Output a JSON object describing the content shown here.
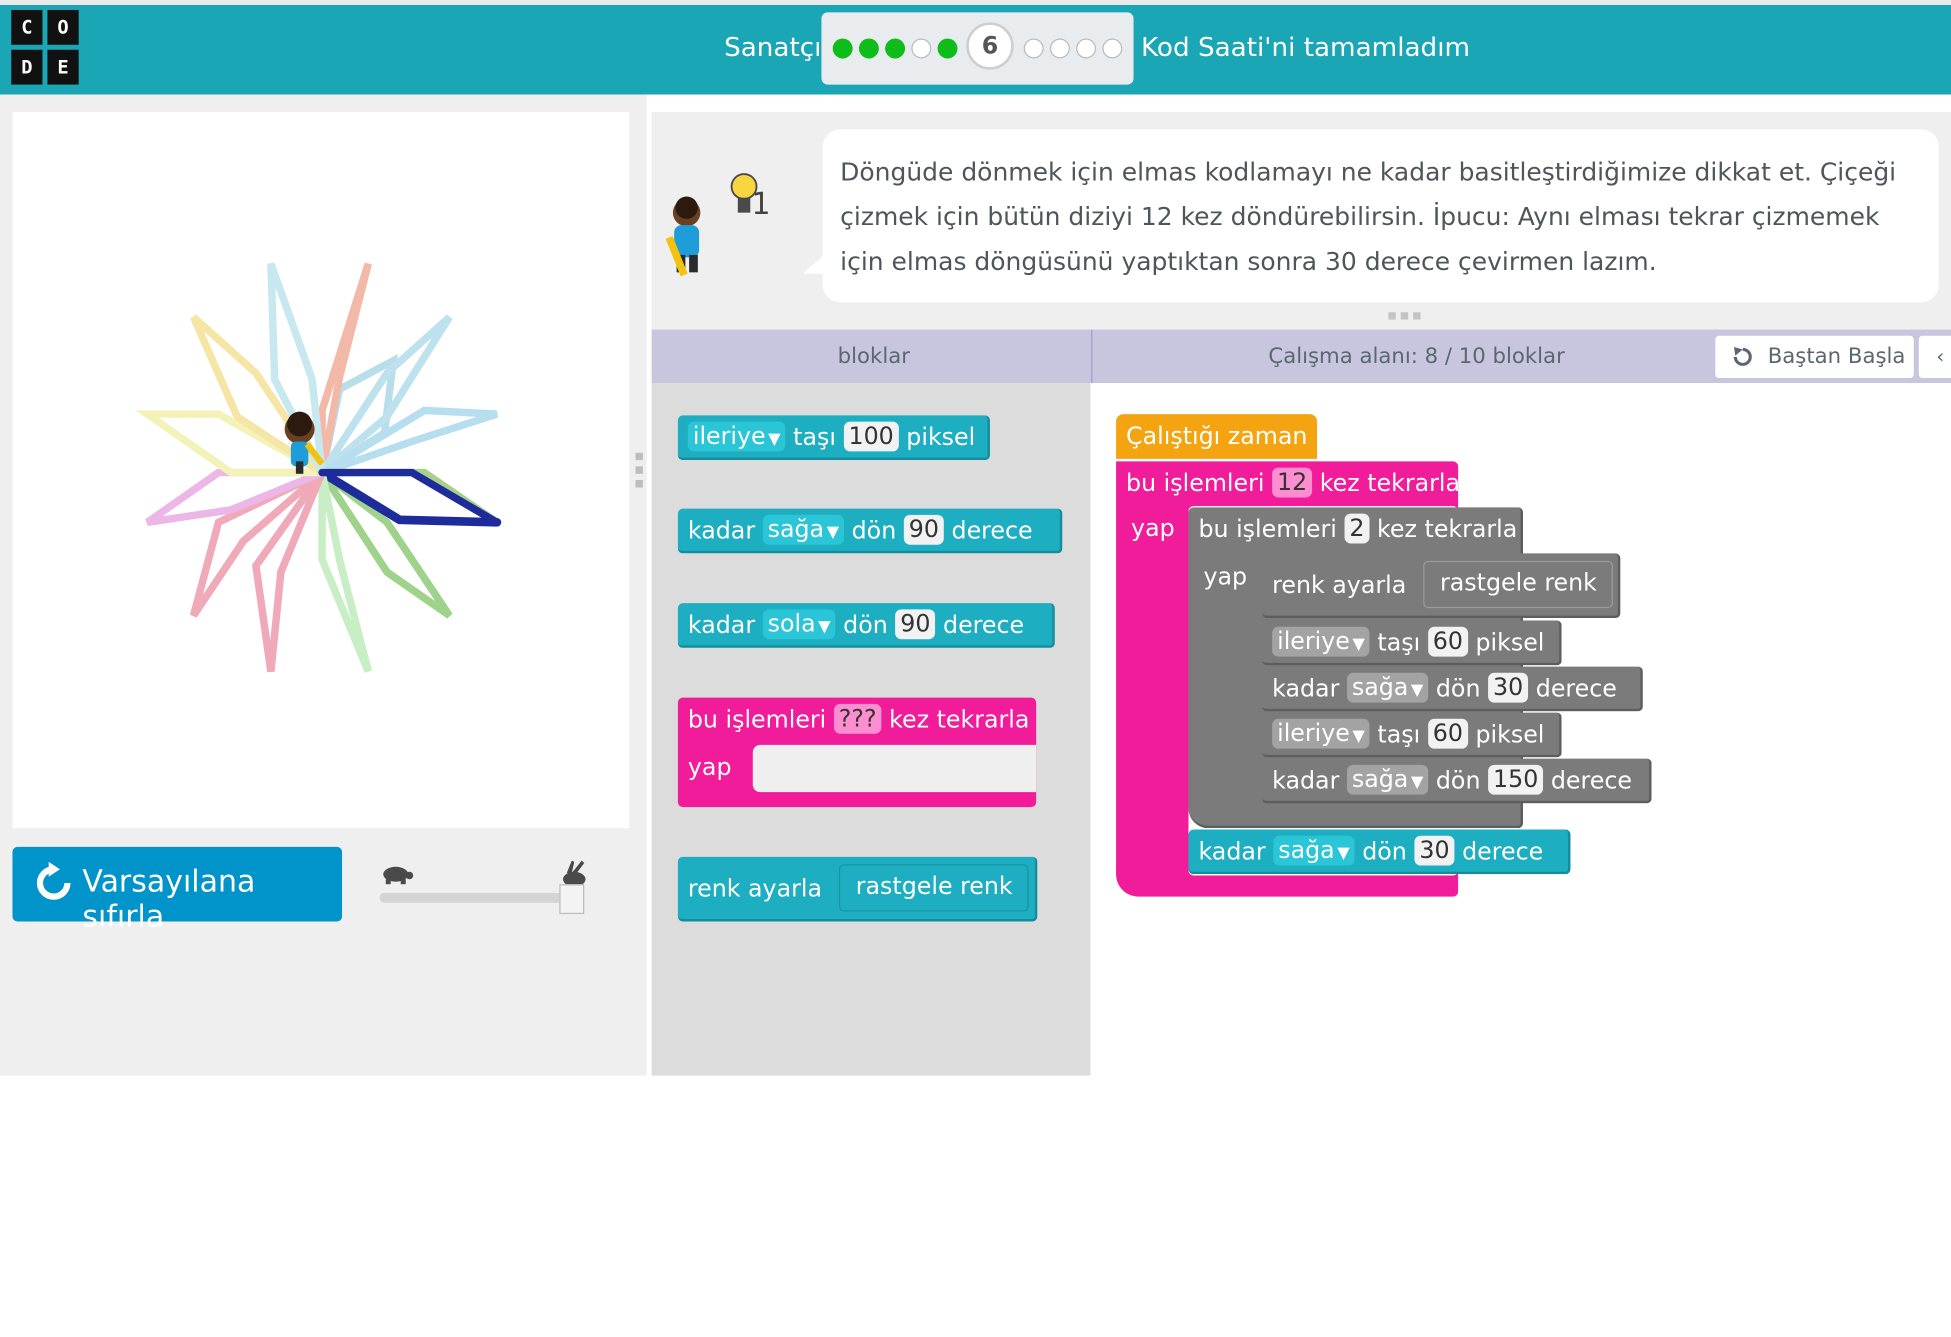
{
  "header": {
    "logo_letters": [
      "C",
      "O",
      "D",
      "E"
    ],
    "title": "Sanatçı",
    "current_level": "6",
    "completed_label": "Kod Saati'ni tamamladım",
    "levels_before": [
      "done",
      "done",
      "done",
      "empty",
      "done"
    ],
    "levels_after": [
      "empty",
      "empty",
      "empty",
      "empty"
    ],
    "colors": {
      "bar": "#1aa6b4",
      "done_dot": "#0ebd1a"
    }
  },
  "instructions": {
    "hint_count": "1",
    "text": "Döngüde dönmek için elmas kodlamayı ne kadar basitleştirdiğimize dikkat et. Çiçeği çizmek için bütün diziyi 12 kez döndürebilirsin. İpucu: Aynı elması tekrar çizmemek için elmas döngüsünü yaptıktan sonra 30 derece çevirmen lazım."
  },
  "controls": {
    "reset_label": "Varsayılana sıfırla",
    "speed_level": 1.0
  },
  "workspace_header": {
    "toolbox_label": "bloklar",
    "workspace_label": "Çalışma alanı: 8 / 10 bloklar",
    "restart_label": "Baştan Başla",
    "extra_glyph": "‹"
  },
  "toolbox": {
    "move_forward": {
      "dir": "ileriye",
      "verb": "taşı",
      "value": "100",
      "unit": "piksel"
    },
    "turn_right": {
      "prefix": "kadar",
      "dir": "sağa",
      "verb": "dön",
      "value": "90",
      "unit": "derece"
    },
    "turn_left": {
      "prefix": "kadar",
      "dir": "sola",
      "verb": "dön",
      "value": "90",
      "unit": "derece"
    },
    "repeat": {
      "prefix": "bu işlemleri",
      "value": "???",
      "suffix": "kez tekrarla",
      "do": "yap"
    },
    "set_color": {
      "label": "renk ayarla",
      "value": "rastgele renk"
    }
  },
  "program": {
    "when_run": "Çalıştığı zaman",
    "outer_repeat": {
      "prefix": "bu işlemleri",
      "value": "12",
      "suffix": "kez tekrarla",
      "do": "yap"
    },
    "inner_repeat": {
      "prefix": "bu işlemleri",
      "value": "2",
      "suffix": "kez tekrarla",
      "do": "yap"
    },
    "set_color": {
      "label": "renk ayarla",
      "value": "rastgele renk"
    },
    "move1": {
      "dir": "ileriye",
      "verb": "taşı",
      "value": "60",
      "unit": "piksel"
    },
    "turn1": {
      "prefix": "kadar",
      "dir": "sağa",
      "verb": "dön",
      "value": "30",
      "unit": "derece"
    },
    "move2": {
      "dir": "ileriye",
      "verb": "taşı",
      "value": "60",
      "unit": "piksel"
    },
    "turn2": {
      "prefix": "kadar",
      "dir": "sağa",
      "verb": "dön",
      "value": "150",
      "unit": "derece"
    },
    "turn_outer": {
      "prefix": "kadar",
      "dir": "sağa",
      "verb": "dön",
      "value": "30",
      "unit": "derece"
    }
  },
  "drawing": {
    "petal_count": 12,
    "petal_colors": [
      "#b8dfe9",
      "#f3b9a8",
      "#bde2ee",
      "#b6deee",
      "#a7d08c",
      "#9fd28a",
      "#1d2b9b",
      "#c8eec6",
      "#f0a9b8",
      "#ecb6e6",
      "#c8e8f0",
      "#f3f2b8",
      "#f6e6a6"
    ]
  }
}
